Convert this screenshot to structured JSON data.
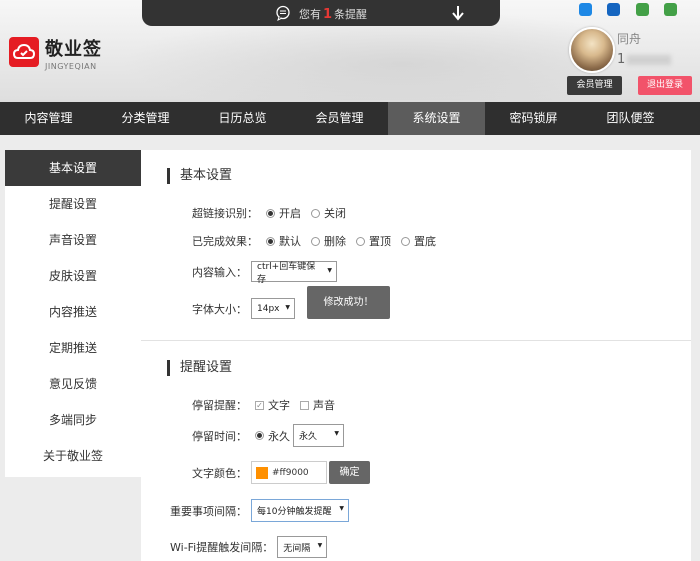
{
  "brand": {
    "name": "敬业签",
    "sub": "JINGYEQIAN"
  },
  "notify": {
    "prefix": "您有",
    "count": "1",
    "suffix": "条提醒"
  },
  "platforms": [
    {
      "icon": "ie-icon",
      "color": "#1e88e5"
    },
    {
      "icon": "windows-icon",
      "color": "#1565c0"
    },
    {
      "icon": "android-icon",
      "color": "#43a047"
    },
    {
      "icon": "android-icon",
      "color": "#43a047"
    }
  ],
  "user": {
    "name": "同舟",
    "phone": "1"
  },
  "buttons": {
    "member": "会员管理",
    "logout": "退出登录"
  },
  "nav": [
    "内容管理",
    "分类管理",
    "日历总览",
    "会员管理",
    "系统设置",
    "密码锁屏",
    "团队便签"
  ],
  "nav_active": "系统设置",
  "sidebar": [
    "基本设置",
    "提醒设置",
    "声音设置",
    "皮肤设置",
    "内容推送",
    "定期推送",
    "意见反馈",
    "多端同步",
    "关于敬业签"
  ],
  "sidebar_active": "基本设置",
  "basic": {
    "title": "基本设置",
    "link_label": "超链接识别：",
    "link_on": "开启",
    "link_off": "关闭",
    "done_label": "已完成效果：",
    "done_opts": [
      "默认",
      "删除",
      "置顶",
      "置底"
    ],
    "input_label": "内容输入：",
    "input_value": "ctrl+回车键保存",
    "font_label": "字体大小：",
    "font_value": "14px",
    "toast": "修改成功！"
  },
  "remind": {
    "title": "提醒设置",
    "stay_label": "停留提醒：",
    "stay_text": "文字",
    "stay_sound": "声音",
    "time_label": "停留时间：",
    "time_radio": "永久",
    "time_value": "永久",
    "color_label": "文字颜色：",
    "color_value": "#ff9000",
    "color_swatch": "#ff9000",
    "confirm": "确定",
    "important_label": "重要事项间隔：",
    "important_value": "每10分钟触发提醒",
    "wifi_label": "Wi-Fi提醒触发间隔：",
    "wifi_value": "无间隔"
  }
}
